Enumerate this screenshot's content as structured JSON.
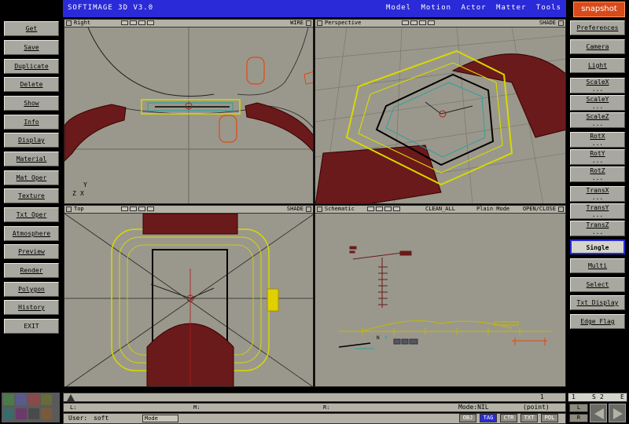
{
  "app": {
    "title": "SOFTIMAGE 3D V3.0",
    "menu": [
      "Model",
      "Motion",
      "Actor",
      "Matter",
      "Tools"
    ],
    "active_menu": "Matter",
    "snapshot_label": "snapshot",
    "accent_color": "#2a2ad8",
    "viewport_bg": "#9a988c"
  },
  "left_panel": [
    "Get",
    "Save",
    "Duplicate",
    "Delete",
    "Show",
    "Info",
    "Display",
    "Material",
    "Mat_Oper",
    "Texture",
    "Txt_Oper",
    "Atmosphere",
    "Preview",
    "Render",
    "Polygon",
    "History",
    "EXIT"
  ],
  "right_panel": {
    "top": [
      "Preferences",
      "Camera",
      "Light"
    ],
    "scale": [
      "ScaleX",
      "ScaleY",
      "ScaleZ"
    ],
    "rot": [
      "RotX",
      "RotY",
      "RotZ"
    ],
    "trans": [
      "TransX",
      "TransY",
      "TransZ"
    ],
    "dots": "...",
    "bottom": [
      "Single",
      "Multi",
      "Select",
      "Txt_Display",
      "Edge_Flag"
    ],
    "active": "Single"
  },
  "viewports": {
    "right": {
      "name": "Right",
      "mode": "WIRE"
    },
    "perspective": {
      "name": "Perspective",
      "mode": "SHADE"
    },
    "top": {
      "name": "Top",
      "mode": "SHADE"
    },
    "schematic": {
      "name": "Schematic",
      "opt1": "CLEAN_ALL",
      "opt2": "Plain Mode",
      "opt3": "OPEN/CLOSE"
    }
  },
  "axes": {
    "y": "Y",
    "z": "Z",
    "x": "X"
  },
  "schematic_labels": {
    "n": "N",
    "v": "V"
  },
  "timeline": {
    "frame": "1"
  },
  "status": {
    "l_label": "L:",
    "m_label": "M:",
    "r_label": "R:",
    "user_label": "User:",
    "user_value": "soft",
    "mode_label": "Mode",
    "mode_text": "Mode:",
    "mode_value": "NIL",
    "mode_detail": "(point)",
    "tabs": [
      "OBJ",
      "TAG",
      "CTR",
      "TXT",
      "POL"
    ],
    "active_tab": "TAG"
  },
  "frames": {
    "start": "1",
    "s_mark": "S",
    "end": "2",
    "e_mark": "E"
  },
  "playback": {
    "left_label": "L",
    "right_label": "R"
  }
}
